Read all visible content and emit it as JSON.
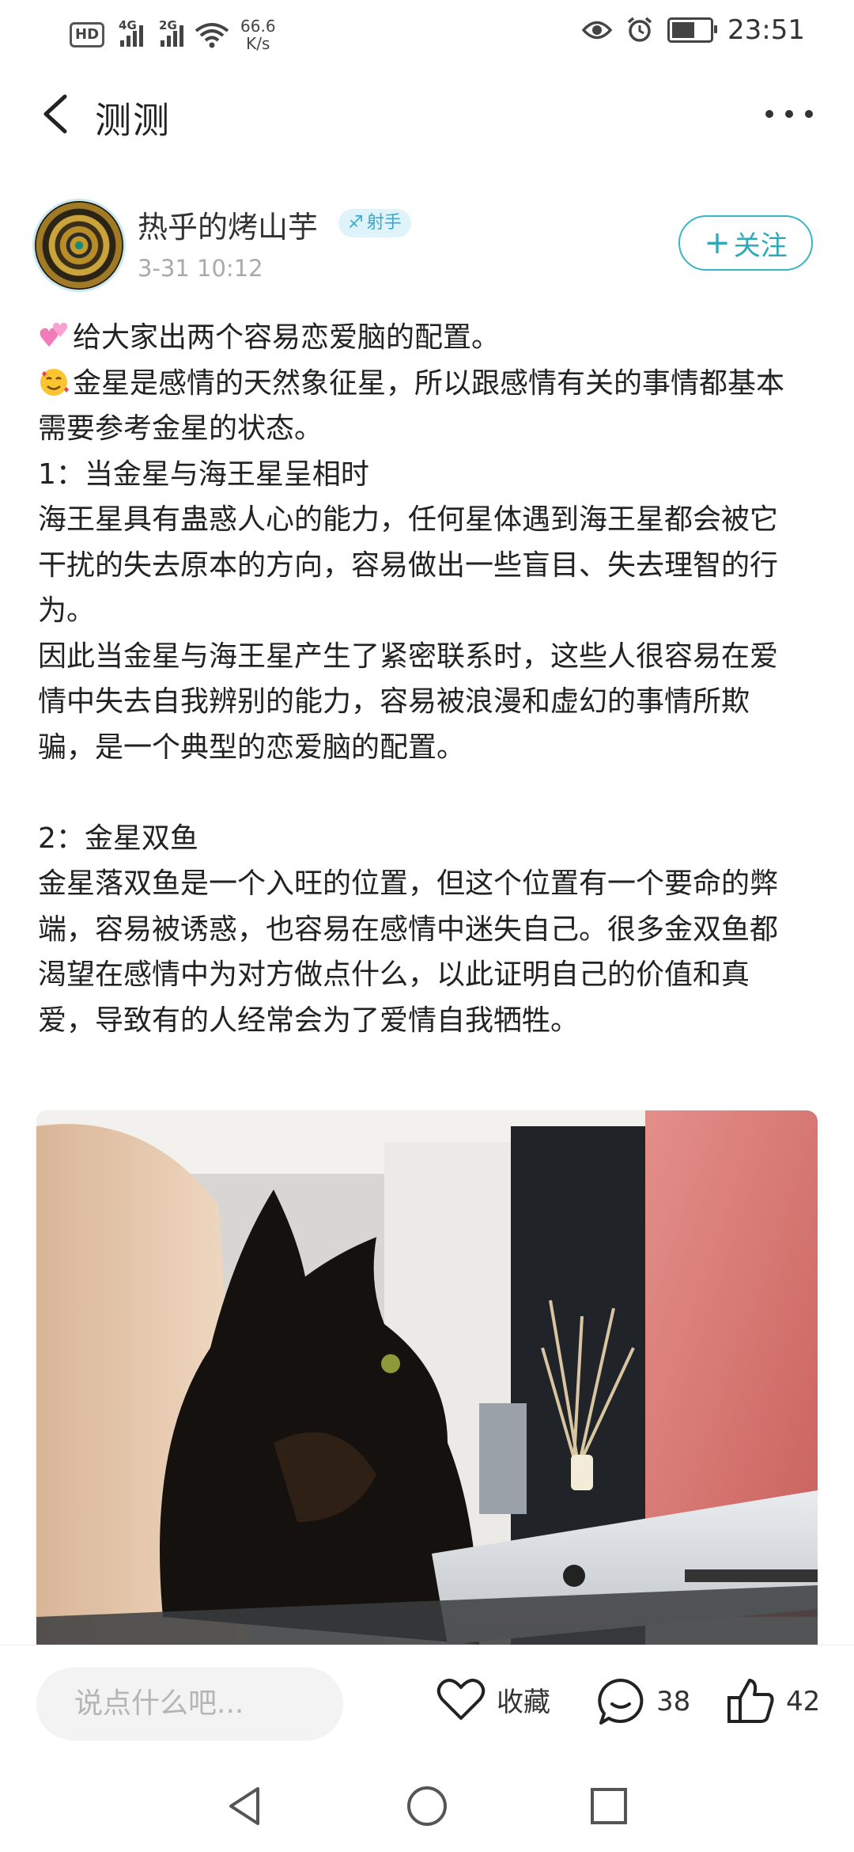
{
  "status_bar": {
    "hd": "HD",
    "sim1": "4G",
    "sim2": "2G",
    "net_speed_value": "66.6",
    "net_speed_unit": "K/s",
    "time": "23:51",
    "battery_level": 0.7,
    "icons": [
      "hd-icon",
      "signal-icon",
      "wifi-icon",
      "eye-icon",
      "alarm-icon",
      "battery-icon"
    ]
  },
  "header": {
    "title": "测测"
  },
  "post": {
    "author": "热乎的烤山芋",
    "zodiac": "射手",
    "zodiac_symbol": "♐",
    "time": "3-31 10:12",
    "follow_label": "关注",
    "follow_plus": "+",
    "lines": [
      "给大家出两个容易恋爱脑的配置。",
      "金星是感情的天然象征星，所以跟感情有关的事情都基本需要参考金星的状态。",
      "1：当金星与海王星呈相时",
      "海王星具有蛊惑人心的能力，任何星体遇到海王星都会被它干扰的失去原本的方向，容易做出一些盲目、失去理智的行为。",
      "因此当金星与海王星产生了紧密联系时，这些人很容易在爱情中失去自我辨别的能力，容易被浪漫和虚幻的事情所欺骗，是一个典型的恋爱脑的配置。",
      "",
      "2：金星双鱼",
      "金星落双鱼是一个入旺的位置，但这个位置有一个要命的弊端，容易被诱惑，也容易在感情中迷失自己。很多金双鱼都渴望在感情中为对方做点什么，以此证明自己的价值和真爱，导致有的人经常会为了爱情自我牺牲。"
    ]
  },
  "action_bar": {
    "comment_placeholder": "说点什么吧...",
    "collect_label": "收藏",
    "comment_count": "38",
    "like_count": "42"
  }
}
